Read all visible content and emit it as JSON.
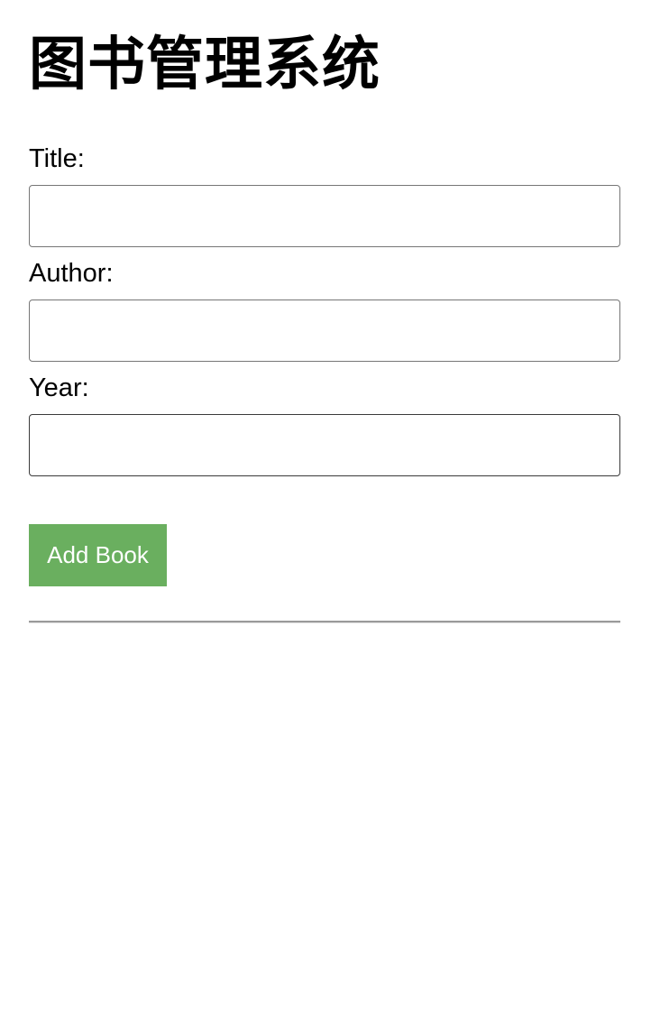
{
  "page": {
    "title": "图书管理系统"
  },
  "form": {
    "fields": [
      {
        "label": "Title:",
        "value": ""
      },
      {
        "label": "Author:",
        "value": ""
      },
      {
        "label": "Year:",
        "value": ""
      }
    ],
    "submit_label": "Add Book"
  },
  "colors": {
    "button_background": "#6aaf5f",
    "button_text": "#ffffff"
  },
  "books": []
}
